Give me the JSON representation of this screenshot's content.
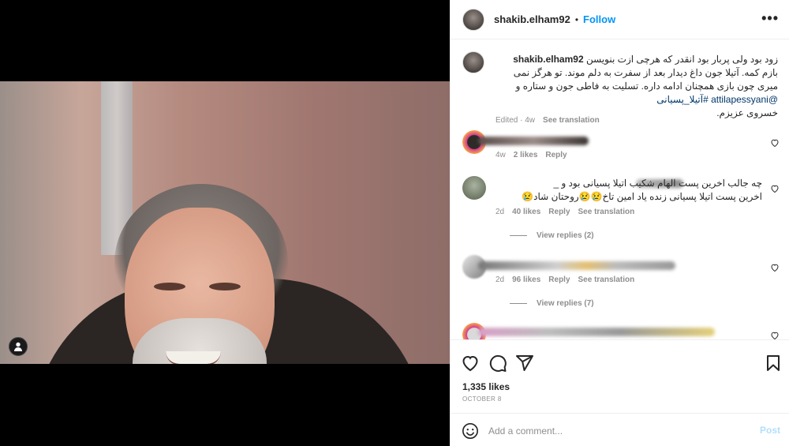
{
  "post": {
    "author": "shakib.elham92",
    "follow_label": "Follow",
    "more_label": "•••",
    "caption": {
      "username": "shakib.elham92",
      "line1": "زود بود ولی پربار بود انقدر که هرچی ازت بنویسن",
      "line2": "بازم کمه. آتیلا جون داغ دیدار بعد از سفرت به دلم موند. تو هرگز نمی",
      "line3": "میری چون بازی همچنان ادامه داره. تسلیت به فاطی جون و ستاره و",
      "mention": "@attilapessyani",
      "hashtag": "#آتیلا_پسیانی",
      "line4": "خسروی عزیزم.",
      "edited": "Edited · 4w",
      "see_translation": "See translation"
    },
    "comments": [
      {
        "text": "",
        "time": "4w",
        "likes": "2 likes",
        "reply": "Reply",
        "see_translation": ""
      },
      {
        "line1": "چه جالب اخرین پست الهام شکیب اتیلا پسیانی بود و ‌_",
        "line2": "اخرین پست اتیلا پسیانی زنده یاد امین تاخ😢😢روحتان شاد😢",
        "time": "2d",
        "likes": "40 likes",
        "reply": "Reply",
        "see_translation": "See translation",
        "view_replies": "View replies (2)"
      },
      {
        "text": "",
        "time": "2d",
        "likes": "96 likes",
        "reply": "Reply",
        "see_translation": "See translation",
        "view_replies": "View replies (7)"
      }
    ],
    "likes": "1,335 likes",
    "date": "OCTOBER 8",
    "comment_placeholder": "Add a comment...",
    "post_label": "Post"
  },
  "colors": {
    "accent": "#0095f6",
    "muted": "#8e8e8e",
    "text": "#262626",
    "link": "#00376b"
  },
  "icons": [
    "user-tag-icon",
    "heart-icon",
    "comment-icon",
    "share-icon",
    "bookmark-icon",
    "emoji-icon",
    "more-icon"
  ]
}
